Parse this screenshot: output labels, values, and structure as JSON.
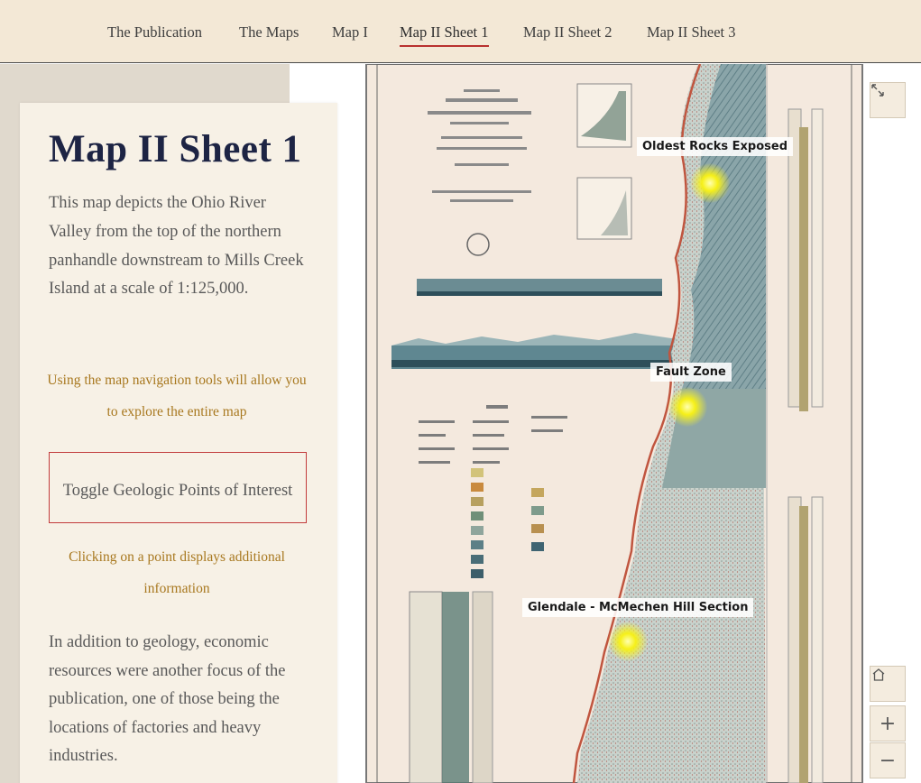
{
  "nav": {
    "items": [
      {
        "label": "The Publication"
      },
      {
        "label": "The Maps"
      },
      {
        "label": "Map I"
      },
      {
        "label": "Map II Sheet 1",
        "active": true
      },
      {
        "label": "Map II Sheet 2"
      },
      {
        "label": "Map II Sheet 3"
      }
    ]
  },
  "panel": {
    "title": "Map II Sheet 1",
    "intro": "This map depicts the Ohio River Valley from the top of the northern panhandle downstream to Mills Creek Island at a scale of 1:125,000.",
    "hint_navigation": "Using the map navigation tools will allow you to explore the entire map",
    "toggle_button": "Toggle Geologic Points of Interest",
    "hint_click": "Clicking on a point displays additional information",
    "bottom_text": "In addition to geology, economic resources were another focus of the publication, one of those being the locations of factories and heavy industries."
  },
  "map": {
    "points": [
      {
        "label": "Oldest Rocks Exposed"
      },
      {
        "label": "Fault Zone"
      },
      {
        "label": "Glendale - McMechen Hill Section"
      }
    ],
    "controls": {
      "fullscreen_icon": "expand-icon",
      "home_icon": "home-icon",
      "zoom_in": "+",
      "zoom_out": "−"
    }
  },
  "colors": {
    "nav_bg": "#f3e8d6",
    "title": "#1d2444",
    "accent_red": "#b8312f",
    "hint_gold": "#a8781f",
    "poi_yellow": "#f6f018"
  }
}
